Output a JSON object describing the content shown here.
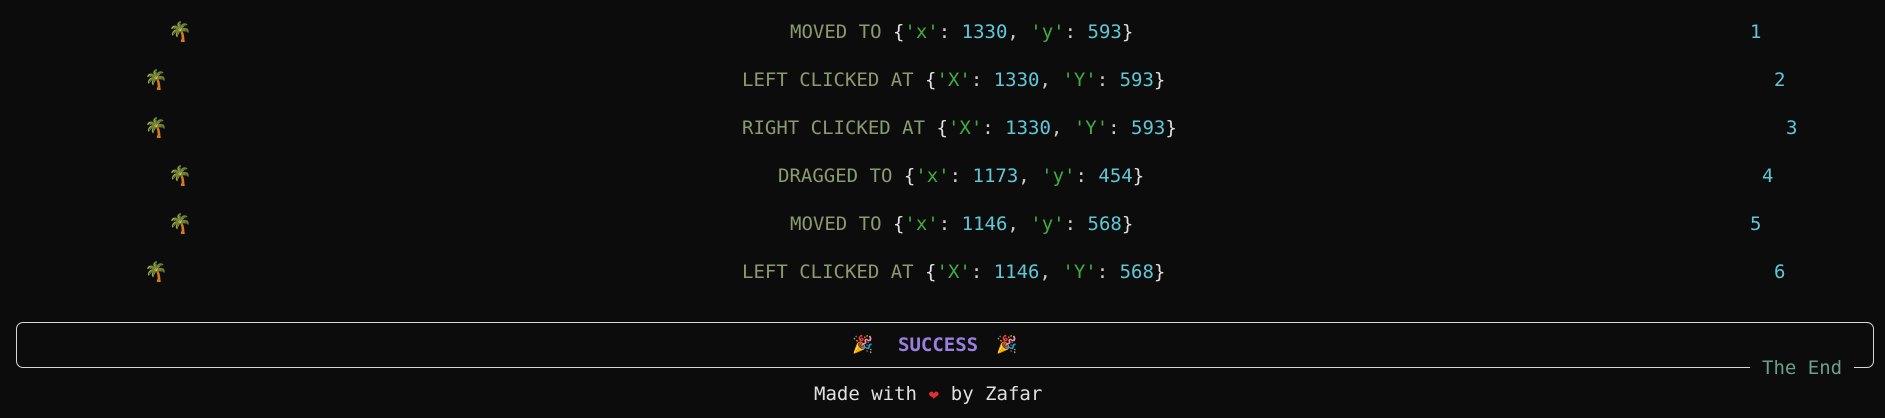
{
  "log": [
    {
      "action": "MOVED TO",
      "k1": "'x'",
      "v1": "1330",
      "k2": "'y'",
      "v2": "593",
      "index": "1"
    },
    {
      "action": "LEFT CLICKED AT",
      "k1": "'X'",
      "v1": "1330",
      "k2": "'Y'",
      "v2": "593",
      "index": "2"
    },
    {
      "action": "RIGHT CLICKED AT",
      "k1": "'X'",
      "v1": "1330",
      "k2": "'Y'",
      "v2": "593",
      "index": "3"
    },
    {
      "action": "DRAGGED TO",
      "k1": "'x'",
      "v1": "1173",
      "k2": "'y'",
      "v2": "454",
      "index": "4"
    },
    {
      "action": "MOVED TO",
      "k1": "'x'",
      "v1": "1146",
      "k2": "'y'",
      "v2": "568",
      "index": "5"
    },
    {
      "action": "LEFT CLICKED AT",
      "k1": "'X'",
      "v1": "1146",
      "k2": "'Y'",
      "v2": "568",
      "index": "6"
    }
  ],
  "icons": {
    "row": "palm-tree-icon",
    "success": "party-popper-icon",
    "footer": "heart-icon"
  },
  "status": {
    "success_label": "SUCCESS",
    "end_label": "The End"
  },
  "footer": {
    "prefix": "Made with",
    "suffix": "by Zafar"
  },
  "colors": {
    "background": "#0c0c0c",
    "action": "#8a9b6e",
    "key": "#3fae3f",
    "number": "#5fc8d8",
    "success": "#9a7fe0",
    "end_label": "#6aa08a",
    "heart": "#e03030"
  }
}
